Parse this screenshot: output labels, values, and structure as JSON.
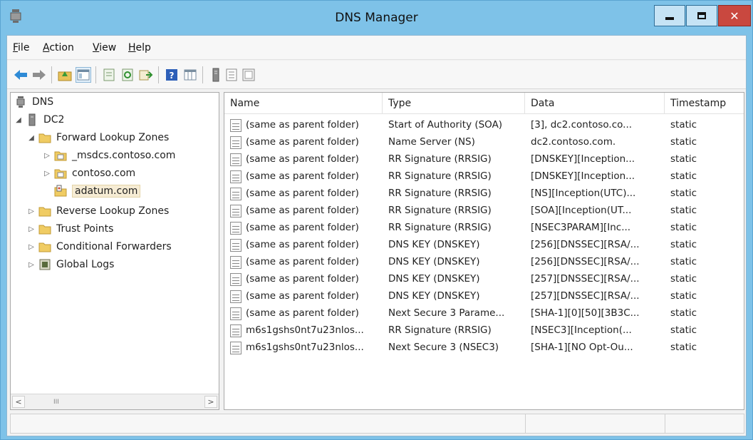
{
  "window": {
    "title": "DNS Manager"
  },
  "menubar": [
    {
      "acc": "F",
      "rest": "ile"
    },
    {
      "acc": "A",
      "rest": "ction"
    },
    {
      "acc": "V",
      "rest": "iew"
    },
    {
      "acc": "H",
      "rest": "elp"
    }
  ],
  "tree": {
    "root": "DNS",
    "server": "DC2",
    "forward_zones": "Forward Lookup Zones",
    "zone_msdcs": "_msdcs.contoso.com",
    "zone_contoso": "contoso.com",
    "zone_adatum": "adatum.com",
    "reverse_zones": "Reverse Lookup Zones",
    "trust_points": "Trust Points",
    "conditional_forwarders": "Conditional Forwarders",
    "global_logs": "Global Logs",
    "scroll_thumb": "III"
  },
  "list": {
    "columns": [
      "Name",
      "Type",
      "Data",
      "Timestamp"
    ],
    "rows": [
      {
        "name": "(same as parent folder)",
        "type": "Start of Authority (SOA)",
        "data": "[3], dc2.contoso.co...",
        "timestamp": "static"
      },
      {
        "name": "(same as parent folder)",
        "type": "Name Server (NS)",
        "data": "dc2.contoso.com.",
        "timestamp": "static"
      },
      {
        "name": "(same as parent folder)",
        "type": "RR Signature (RRSIG)",
        "data": "[DNSKEY][Inception...",
        "timestamp": "static"
      },
      {
        "name": "(same as parent folder)",
        "type": "RR Signature (RRSIG)",
        "data": "[DNSKEY][Inception...",
        "timestamp": "static"
      },
      {
        "name": "(same as parent folder)",
        "type": "RR Signature (RRSIG)",
        "data": "[NS][Inception(UTC)...",
        "timestamp": "static"
      },
      {
        "name": "(same as parent folder)",
        "type": "RR Signature (RRSIG)",
        "data": "[SOA][Inception(UT...",
        "timestamp": "static"
      },
      {
        "name": "(same as parent folder)",
        "type": "RR Signature (RRSIG)",
        "data": "[NSEC3PARAM][Inc...",
        "timestamp": "static"
      },
      {
        "name": "(same as parent folder)",
        "type": "DNS KEY (DNSKEY)",
        "data": "[256][DNSSEC][RSA/...",
        "timestamp": "static"
      },
      {
        "name": "(same as parent folder)",
        "type": "DNS KEY (DNSKEY)",
        "data": "[256][DNSSEC][RSA/...",
        "timestamp": "static"
      },
      {
        "name": "(same as parent folder)",
        "type": "DNS KEY (DNSKEY)",
        "data": "[257][DNSSEC][RSA/...",
        "timestamp": "static"
      },
      {
        "name": "(same as parent folder)",
        "type": "DNS KEY (DNSKEY)",
        "data": "[257][DNSSEC][RSA/...",
        "timestamp": "static"
      },
      {
        "name": "(same as parent folder)",
        "type": "Next Secure 3 Parame...",
        "data": "[SHA-1][0][50][3B3C...",
        "timestamp": "static"
      },
      {
        "name": "m6s1gshs0nt7u23nlos...",
        "type": "RR Signature (RRSIG)",
        "data": "[NSEC3][Inception(...",
        "timestamp": "static"
      },
      {
        "name": "m6s1gshs0nt7u23nlos...",
        "type": "Next Secure 3 (NSEC3)",
        "data": "[SHA-1][NO Opt-Ou...",
        "timestamp": "static"
      }
    ]
  },
  "icons": {
    "back": "back-arrow-icon",
    "forward": "forward-arrow-icon",
    "up": "up-folder-icon",
    "show_tree": "console-tree-icon",
    "properties": "properties-icon",
    "refresh": "refresh-icon",
    "export": "export-list-icon",
    "help": "help-icon",
    "grid": "grid-icon",
    "server": "server-icon",
    "list": "list-icon",
    "records": "records-icon"
  },
  "colors": {
    "accent": "#7ec2e8",
    "close": "#c9483f",
    "folder": "#f0cc63",
    "selection": "#f6ecd4"
  }
}
